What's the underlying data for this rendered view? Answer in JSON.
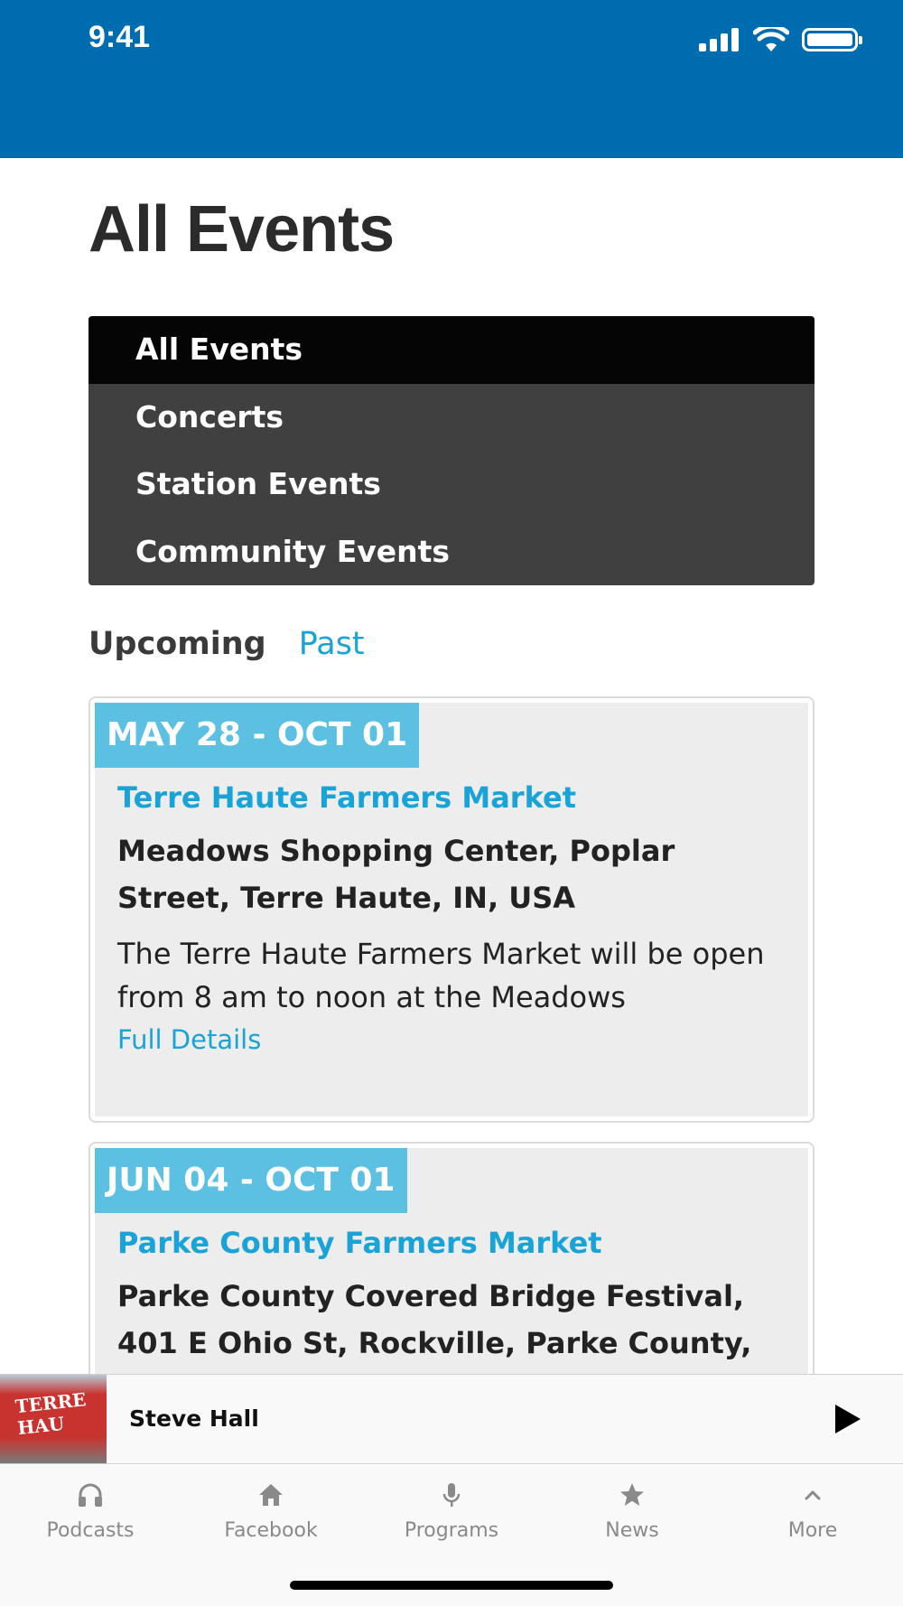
{
  "status_bar": {
    "time": "9:41"
  },
  "page": {
    "title": "All Events"
  },
  "categories": [
    {
      "label": "All Events",
      "active": true
    },
    {
      "label": "Concerts",
      "active": false
    },
    {
      "label": "Station Events",
      "active": false
    },
    {
      "label": "Community Events",
      "active": false
    }
  ],
  "time_tabs": {
    "upcoming": "Upcoming",
    "past": "Past"
  },
  "events": [
    {
      "date": "MAY 28 - OCT 01",
      "title": "Terre Haute Farmers Market",
      "location": "Meadows Shopping Center, Poplar Street, Terre Haute, IN, USA",
      "description": "The Terre Haute Farmers Market will be open from 8 am to noon at the Meadows",
      "link": "Full Details"
    },
    {
      "date": "JUN 04 - OCT 01",
      "title": "Parke County Farmers Market",
      "location": "Parke County Covered Bridge Festival, 401 E Ohio St, Rockville, Parke County,"
    }
  ],
  "player": {
    "name": "Steve Hall",
    "art_text": "TERRE HAU"
  },
  "bottom_nav": [
    {
      "label": "Podcasts",
      "icon": "headphones-icon"
    },
    {
      "label": "Facebook",
      "icon": "home-icon"
    },
    {
      "label": "Programs",
      "icon": "microphone-icon"
    },
    {
      "label": "News",
      "icon": "star-icon"
    },
    {
      "label": "More",
      "icon": "chevron-up-icon"
    }
  ],
  "colors": {
    "header_blue": "#006cb0",
    "accent": "#1aa3d6",
    "date_badge": "#5bc0e2"
  }
}
